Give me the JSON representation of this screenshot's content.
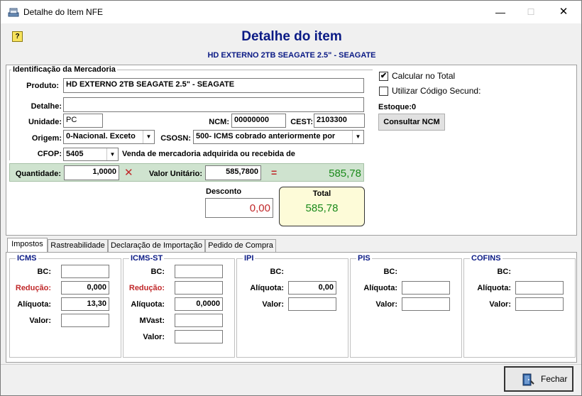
{
  "window": {
    "title": "Detalhe do Item NFE",
    "minimize": "—",
    "maximize": "☐",
    "close": "✕"
  },
  "header": {
    "help": "?",
    "title": "Detalhe do item",
    "subtitle": "HD EXTERNO 2TB SEAGATE 2.5\" - SEAGATE"
  },
  "identificacao": {
    "legend": "Identificação da Mercadoria",
    "produto_label": "Produto:",
    "produto_value": "HD EXTERNO 2TB SEAGATE 2.5\" - SEAGATE",
    "detalhe_label": "Detalhe:",
    "detalhe_value": "",
    "unidade_label": "Unidade:",
    "unidade_value": "PC",
    "ncm_label": "NCM:",
    "ncm_value": "00000000",
    "cest_label": "CEST:",
    "cest_value": "2103300",
    "origem_label": "Origem:",
    "origem_value": "0-Nacional. Exceto",
    "csosn_label": "CSOSN:",
    "csosn_value": "500- ICMS cobrado anteriormente por",
    "cfop_label": "CFOP:",
    "cfop_value": "5405",
    "cfop_desc": "Venda de mercadoria adquirida ou recebida de"
  },
  "right_options": {
    "calcular_label": "Calcular no Total",
    "calcular_checked": true,
    "utilizar_label": "Utilizar Código Secund:",
    "utilizar_checked": false,
    "estoque_label": "Estoque:0",
    "consultar_button": "Consultar NCM"
  },
  "valores": {
    "quantidade_label": "Quantidade:",
    "quantidade_value": "1,0000",
    "times_symbol": "✕",
    "valor_unitario_label": "Valor Unitário:",
    "valor_unitario_value": "585,7800",
    "equals_symbol": "=",
    "subtotal": "585,78",
    "desconto_label": "Desconto",
    "desconto_value": "0,00",
    "total_label": "Total",
    "total_value": "585,78"
  },
  "tabs": [
    {
      "label": "Impostos"
    },
    {
      "label": "Rastreabilidade"
    },
    {
      "label": "Declaração de Importação"
    },
    {
      "label": "Pedido de Compra"
    }
  ],
  "taxes": {
    "icms": {
      "title": "ICMS",
      "bc_label": "BC:",
      "bc_value": "",
      "reducao_label": "Redução:",
      "reducao_value": "0,000",
      "aliquota_label": "Alíquota:",
      "aliquota_value": "13,30",
      "valor_label": "Valor:",
      "valor_value": ""
    },
    "icms_st": {
      "title": "ICMS-ST",
      "bc_label": "BC:",
      "bc_value": "",
      "reducao_label": "Redução:",
      "reducao_value": "",
      "aliquota_label": "Alíquota:",
      "aliquota_value": "0,0000",
      "mvast_label": "MVast:",
      "mvast_value": "",
      "valor_label": "Valor:",
      "valor_value": ""
    },
    "ipi": {
      "title": "IPI",
      "bc_label": "BC:",
      "aliquota_label": "Alíquota:",
      "aliquota_value": "0,00",
      "valor_label": "Valor:",
      "valor_value": ""
    },
    "pis": {
      "title": "PIS",
      "bc_label": "BC:",
      "aliquota_label": "Alíquota:",
      "aliquota_value": "",
      "valor_label": "Valor:",
      "valor_value": ""
    },
    "cofins": {
      "title": "COFINS",
      "bc_label": "BC:",
      "aliquota_label": "Alíquota:",
      "aliquota_value": "",
      "valor_label": "Valor:",
      "valor_value": ""
    }
  },
  "footer": {
    "close_button": "Fechar"
  },
  "colors": {
    "title_blue": "#0a1a85",
    "green_value": "#1a8a1a",
    "red_value": "#c0282a",
    "total_bg": "#fdfbd8"
  }
}
